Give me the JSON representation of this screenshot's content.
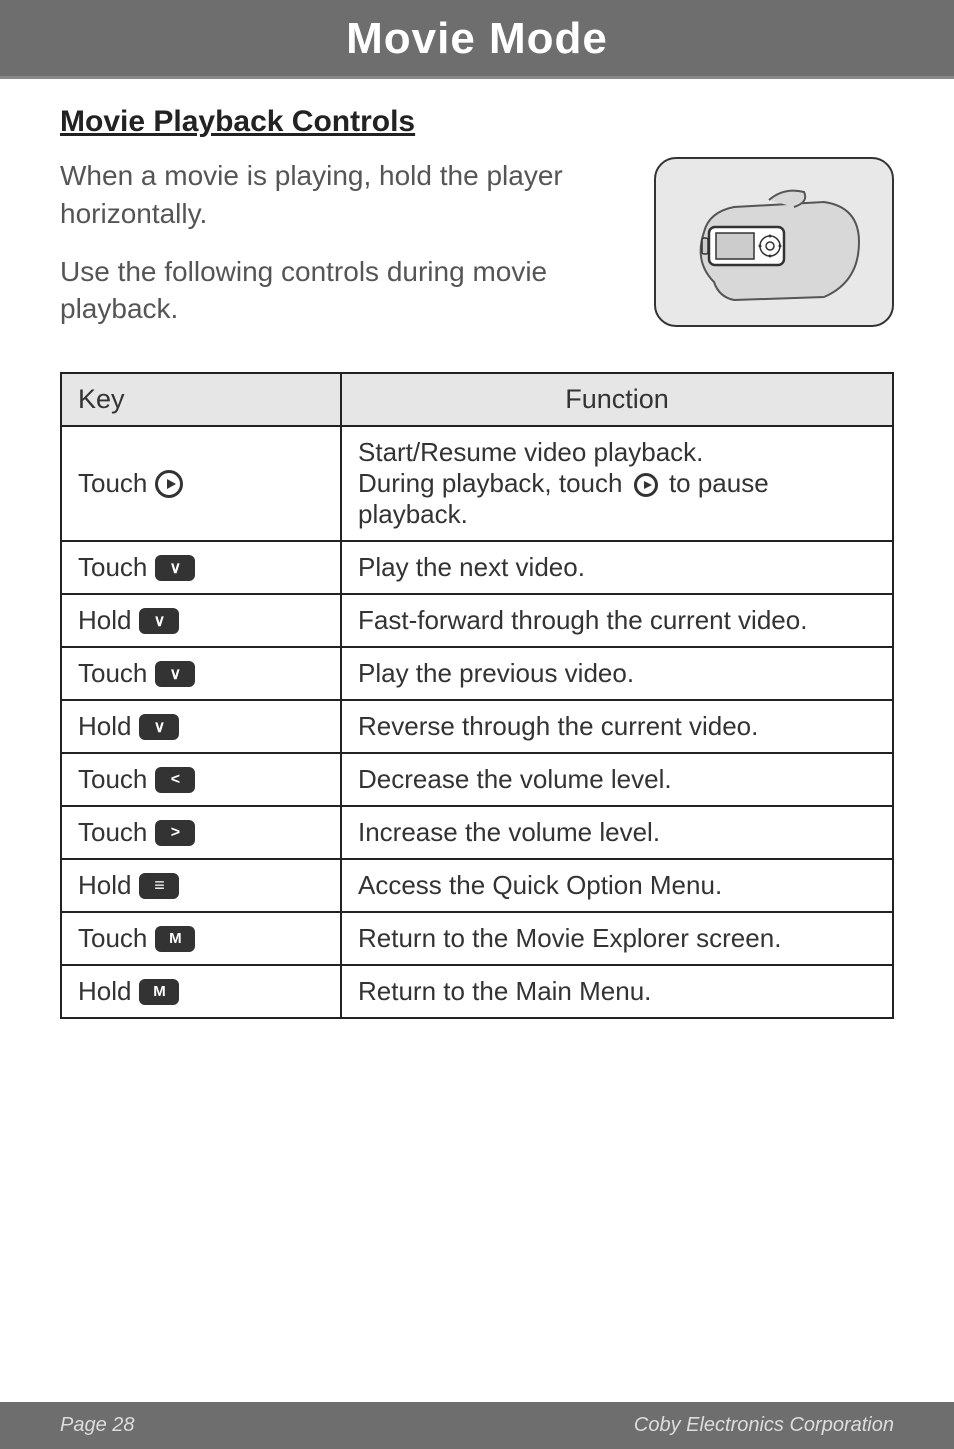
{
  "titleBar": {
    "title": "Movie Mode"
  },
  "section": {
    "heading": "Movie Playback Controls"
  },
  "intro": {
    "p1": "When a movie is playing, hold the player horizontally.",
    "p2": "Use the following controls during movie playback."
  },
  "table": {
    "headers": {
      "key": "Key",
      "function": "Function"
    },
    "rows": [
      {
        "keyAction": "Touch",
        "iconType": "play-circle",
        "func_pre": "Start/Resume video playback.\nDuring playback, touch ",
        "func_post": " to pause playback.",
        "hasInlineIcon": true
      },
      {
        "keyAction": "Touch",
        "iconType": "chev-down",
        "func": "Play the next video."
      },
      {
        "keyAction": "Hold",
        "iconType": "chev-down",
        "func": "Fast-forward through the current video."
      },
      {
        "keyAction": "Touch",
        "iconType": "chev-down",
        "func": "Play the previous video."
      },
      {
        "keyAction": "Hold",
        "iconType": "chev-down",
        "func": "Reverse through the current video."
      },
      {
        "keyAction": "Touch",
        "iconType": "chev-left",
        "func": "Decrease the volume level."
      },
      {
        "keyAction": "Touch",
        "iconType": "chev-right",
        "func": "Increase the volume level."
      },
      {
        "keyAction": "Hold",
        "iconType": "menu",
        "func": "Access the Quick Option Menu."
      },
      {
        "keyAction": "Touch",
        "iconType": "m",
        "func": "Return to the Movie Explorer screen."
      },
      {
        "keyAction": "Hold",
        "iconType": "m",
        "func": "Return to the Main Menu."
      }
    ]
  },
  "footer": {
    "pageLabel": "Page 28",
    "company": "Coby Electronics Corporation"
  }
}
